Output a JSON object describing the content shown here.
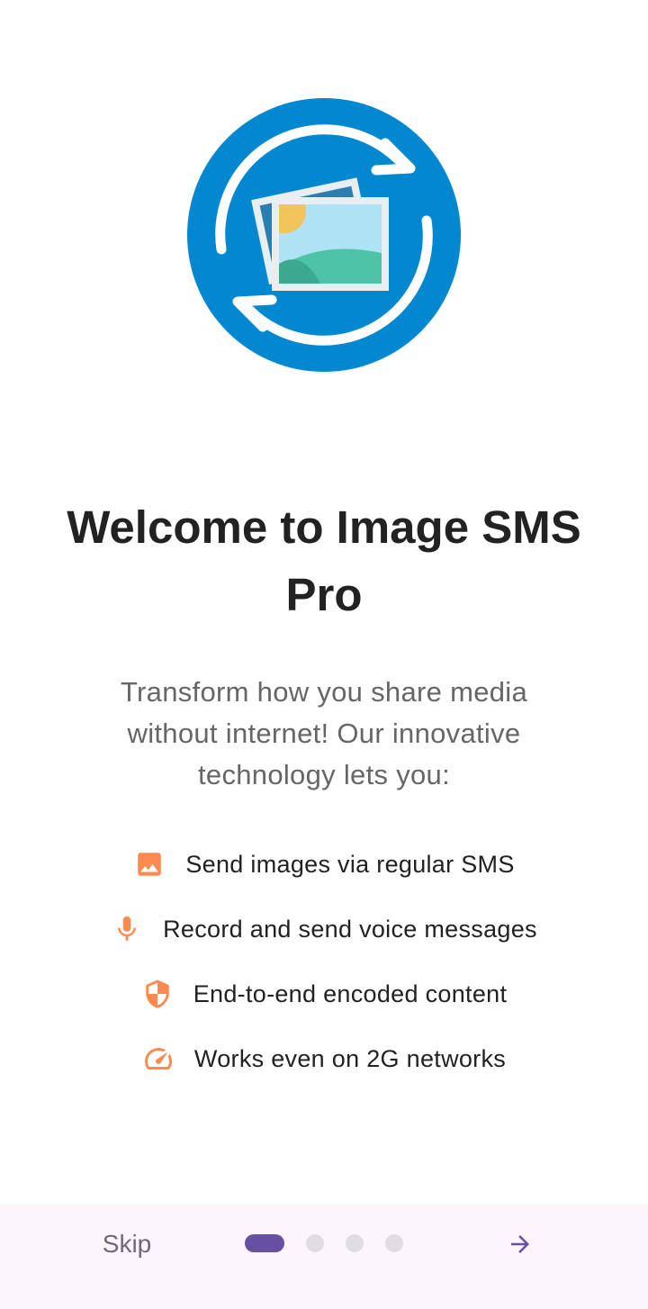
{
  "onboarding": {
    "title": "Welcome to Image SMS Pro",
    "subtitle": "Transform how you share media without internet! Our innovative technology lets you:",
    "features": [
      {
        "icon": "image-icon",
        "label": "Send images via regular SMS"
      },
      {
        "icon": "microphone-icon",
        "label": "Record and send voice messages"
      },
      {
        "icon": "shield-icon",
        "label": "End-to-end encoded content"
      },
      {
        "icon": "speedometer-icon",
        "label": "Works even on 2G networks"
      }
    ]
  },
  "nav": {
    "skip_label": "Skip",
    "page_count": 4,
    "current_page": 1,
    "next_icon": "arrow-right-icon"
  },
  "colors": {
    "logo_blue": "#0288d1",
    "feature_icon": "#ff8a50",
    "accent": "#6750a4",
    "inactive_dot": "#e0dde2",
    "bottom_bar": "#fcf6fc"
  }
}
